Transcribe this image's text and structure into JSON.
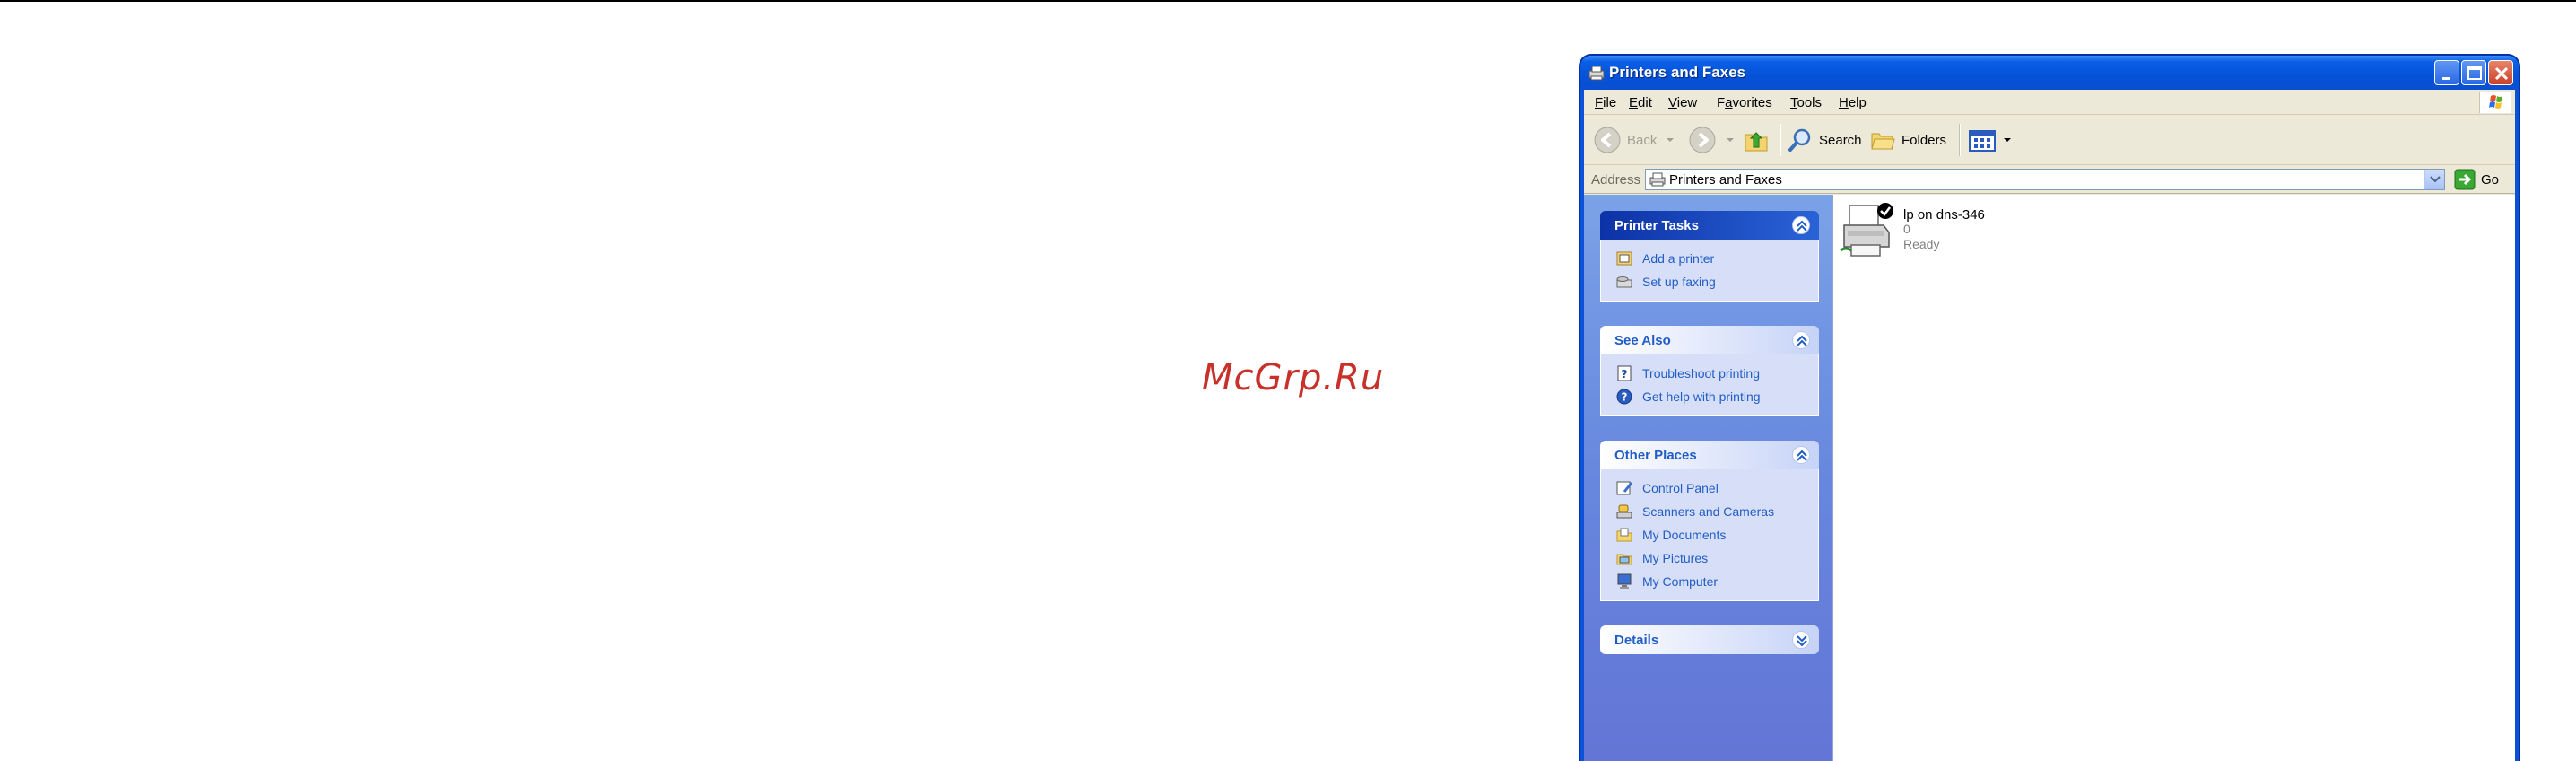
{
  "watermark": "McGrp.Ru",
  "window": {
    "title": "Printers and Faxes",
    "menu": {
      "file": {
        "mnemonic": "F",
        "rest": "ile"
      },
      "edit": {
        "mnemonic": "E",
        "rest": "dit"
      },
      "view": {
        "mnemonic": "V",
        "rest": "iew"
      },
      "favorites": {
        "pre": "F",
        "mnemonic": "a",
        "rest": "vorites"
      },
      "tools": {
        "mnemonic": "T",
        "rest": "ools"
      },
      "help": {
        "mnemonic": "H",
        "rest": "elp"
      }
    },
    "toolbar": {
      "back": "Back",
      "search": "Search",
      "folders": "Folders"
    },
    "address": {
      "label": "Address",
      "value": "Printers and Faxes",
      "go": "Go"
    }
  },
  "tasks": {
    "printer_tasks": {
      "title": "Printer Tasks",
      "links": [
        "Add a printer",
        "Set up faxing"
      ]
    },
    "see_also": {
      "title": "See Also",
      "links": [
        "Troubleshoot printing",
        "Get help with printing"
      ]
    },
    "other_places": {
      "title": "Other Places",
      "links": [
        "Control Panel",
        "Scanners and Cameras",
        "My Documents",
        "My Pictures",
        "My Computer"
      ]
    },
    "details": {
      "title": "Details"
    }
  },
  "printers": [
    {
      "name": "lp on dns-346",
      "documents": "0",
      "status": "Ready",
      "icon": "printer-default-icon"
    }
  ],
  "colors": {
    "title_blue": "#0552d8",
    "task_link": "#215dc6",
    "pane_gradient_top": "#7ba2e7",
    "pane_gradient_bottom": "#6375d6",
    "watermark": "#c8302a"
  }
}
